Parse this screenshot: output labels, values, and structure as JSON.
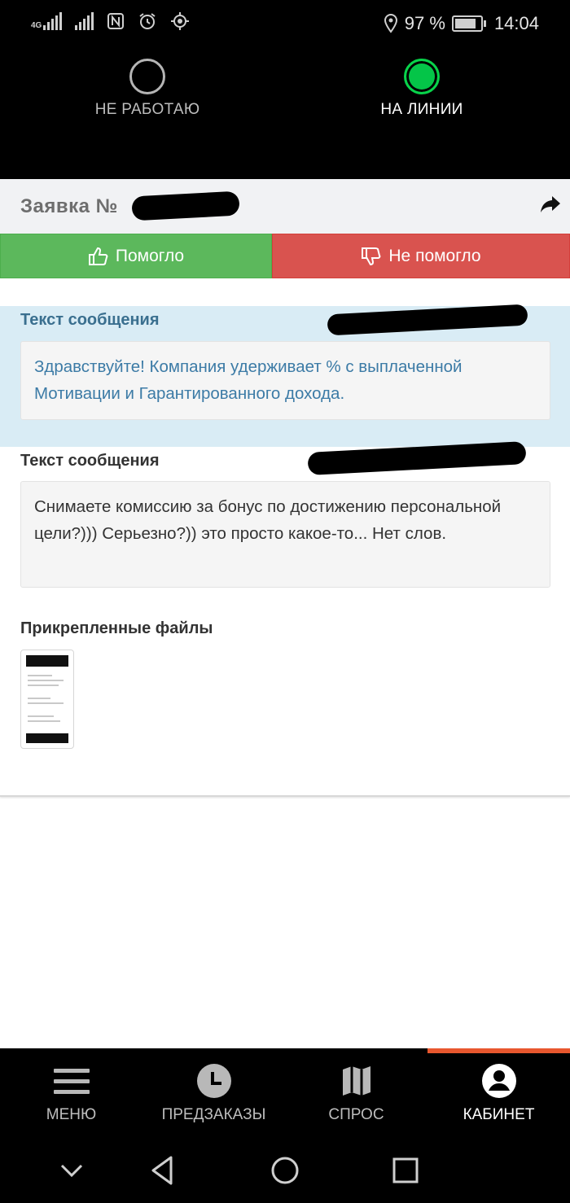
{
  "status_bar": {
    "network": "4G",
    "battery": "97 %",
    "battery_level": 0.97,
    "time": "14:04",
    "icons": [
      "signal-icon",
      "nfc-icon",
      "alarm-icon",
      "location-target-icon",
      "location-pin-icon",
      "battery-icon"
    ]
  },
  "header": {
    "mode_off_label": "НЕ РАБОТАЮ",
    "mode_on_label": "НА ЛИНИИ",
    "active_mode": "НА ЛИНИИ",
    "online_color": "#04c548"
  },
  "order": {
    "title": "Заявка №",
    "helped_label": "Помогло",
    "not_helped_label": "Не помогло",
    "helped_color": "#5cb85c",
    "not_helped_color": "#d9534f"
  },
  "messages": [
    {
      "label": "Текст сообщения",
      "text": "Здравствуйте! Компания удерживает % с выплаченной Мотивации и Гарантированного дохода."
    },
    {
      "label": "Текст сообщения",
      "text": "Снимаете комиссию за бонус по достижению персональной цели?))) Серьезно?)) это просто какое-то... Нет слов."
    }
  ],
  "attachments": {
    "label": "Прикрепленные файлы",
    "count": 1
  },
  "bottom_nav": {
    "items": [
      {
        "label": "МЕНЮ",
        "icon": "menu-icon"
      },
      {
        "label": "ПРЕДЗАКАЗЫ",
        "icon": "clock-icon"
      },
      {
        "label": "СПРОС",
        "icon": "map-icon"
      },
      {
        "label": "КАБИНЕТ",
        "icon": "user-icon"
      }
    ],
    "active": "КАБИНЕТ",
    "active_color": "#e8572e"
  }
}
